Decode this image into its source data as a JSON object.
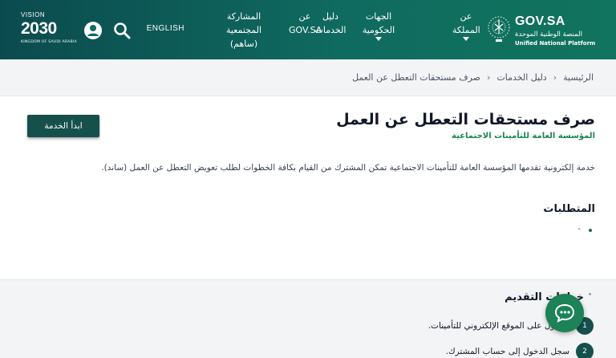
{
  "header": {
    "logo": {
      "title": "GOV.SA",
      "subtitle_ar": "المنصة الوطنية الموحدة",
      "subtitle_en": "Unified National Platform"
    },
    "nav": [
      {
        "label": "عن المملكة",
        "has_dropdown": true
      },
      {
        "label": "الجهات الحكومية",
        "has_dropdown": true
      },
      {
        "label": "دليل الخدمات",
        "has_dropdown": false
      },
      {
        "label": "عن GOV.SA",
        "has_dropdown": false
      },
      {
        "label": "المشاركة المجتمعية (ساهم)",
        "has_dropdown": false
      }
    ],
    "language_label": "ENGLISH",
    "vision": {
      "top": "VISION",
      "year": "2030",
      "subtitle": "KINGDOM OF SAUDI ARABIA"
    },
    "colors": {
      "header_start": "#0b4b4f",
      "header_end": "#11745e",
      "accent_green": "#1b8354",
      "button_dark": "#15504c"
    }
  },
  "breadcrumb": [
    "الرئيسية",
    "دليل الخدمات",
    "صرف مستحقات التعطل عن العمل"
  ],
  "service": {
    "title": "صرف مستحقات التعطل عن العمل",
    "agency": "المؤسسة العامة للتأمينات الاجتماعية",
    "start_button_label": "ابدأ الخدمة",
    "description": "خدمة إلكترونية تقدمها المؤسسة العامة للتأمينات الاجتماعية تمكن المشترك من القيام بكافة الخطوات لطلب تعويض التعطل عن العمل (ساند).",
    "requirements_title": "المتطلبات",
    "requirements": [
      "-"
    ]
  },
  "steps": {
    "title": "خطوات التقديم",
    "items": [
      {
        "number": "1",
        "text": "الدخول على الموقع الإلكتروني للتأمينات."
      },
      {
        "number": "2",
        "text": "سجل الدخول إلى حساب المشترك."
      }
    ]
  }
}
